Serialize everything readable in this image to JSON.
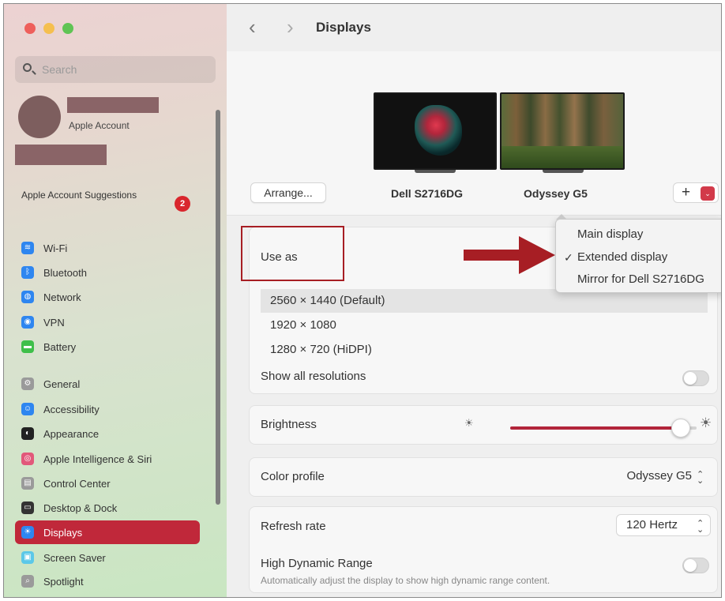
{
  "sidebar": {
    "search_placeholder": "Search",
    "account_label": "Apple Account",
    "suggestions_label": "Apple Account Suggestions",
    "suggestions_badge": "2",
    "items": [
      {
        "label": "Wi-Fi",
        "icon": "wifi-icon",
        "color": "#2e86f0"
      },
      {
        "label": "Bluetooth",
        "icon": "bluetooth-icon",
        "color": "#2e86f0"
      },
      {
        "label": "Network",
        "icon": "globe-icon",
        "color": "#2e86f0"
      },
      {
        "label": "VPN",
        "icon": "vpn-icon",
        "color": "#2e86f0"
      },
      {
        "label": "Battery",
        "icon": "battery-icon",
        "color": "#3fbf4a"
      },
      {
        "label": "General",
        "icon": "gear-icon",
        "color": "#9a9a9a"
      },
      {
        "label": "Accessibility",
        "icon": "accessibility-icon",
        "color": "#2e86f0"
      },
      {
        "label": "Appearance",
        "icon": "appearance-icon",
        "color": "#222222"
      },
      {
        "label": "Apple Intelligence & Siri",
        "icon": "siri-icon",
        "color": "#e2587a"
      },
      {
        "label": "Control Center",
        "icon": "control-center-icon",
        "color": "#9a9a9a"
      },
      {
        "label": "Desktop & Dock",
        "icon": "dock-icon",
        "color": "#333333"
      },
      {
        "label": "Displays",
        "icon": "sun-icon",
        "color": "#2e86f0"
      },
      {
        "label": "Screen Saver",
        "icon": "screen-saver-icon",
        "color": "#5cc8e8"
      },
      {
        "label": "Spotlight",
        "icon": "spotlight-icon",
        "color": "#9a9a9a"
      }
    ],
    "active_item": "Displays"
  },
  "header": {
    "back": "‹",
    "forward": "›",
    "title": "Displays"
  },
  "arrangement": {
    "arrange_button": "Arrange...",
    "display_1": "Dell S2716DG",
    "display_2": "Odyssey G5",
    "plus": "+",
    "dropdown_glyph": "⌄"
  },
  "use_as": {
    "label": "Use as",
    "menu": {
      "checkmark": "✓",
      "options": [
        "Main display",
        "Extended display",
        "Mirror for Dell S2716DG"
      ],
      "selected": "Extended display"
    }
  },
  "resolutions": {
    "options": [
      "2560 × 1440 (Default)",
      "1920 × 1080",
      "1280 × 720 (HiDPI)"
    ],
    "selected": "2560 × 1440 (Default)",
    "show_all_label": "Show all resolutions",
    "show_all_enabled": false
  },
  "brightness": {
    "label": "Brightness",
    "level": 0.96
  },
  "color_profile": {
    "label": "Color profile",
    "value": "Odyssey G5"
  },
  "refresh_rate": {
    "label": "Refresh rate",
    "value": "120 Hertz"
  },
  "hdr": {
    "label": "High Dynamic Range",
    "description": "Automatically adjust the display to show high dynamic range content.",
    "enabled": false
  },
  "colors": {
    "accent": "#c0283a",
    "annotation": "#a71e24",
    "close": "#ee5f5b",
    "minimize": "#f5bf4f",
    "zoom": "#5fc454"
  }
}
